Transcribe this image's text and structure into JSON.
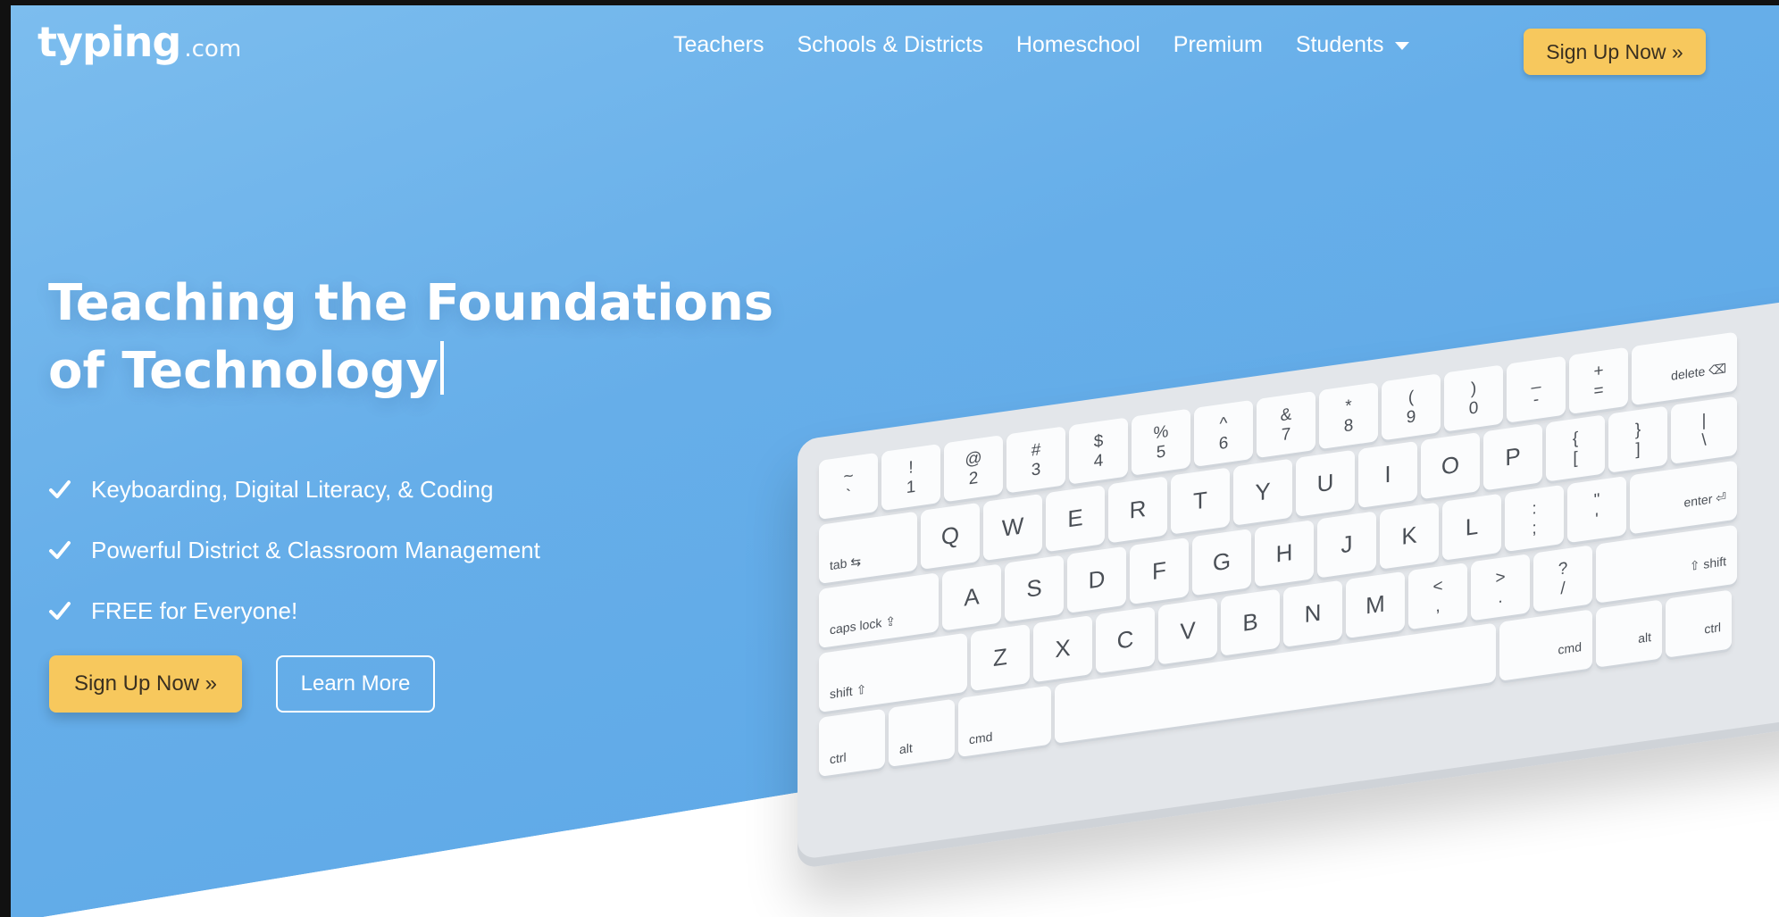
{
  "header": {
    "logo_main": "typing",
    "logo_suffix": ".com",
    "nav": {
      "teachers": "Teachers",
      "schools": "Schools & Districts",
      "homeschool": "Homeschool",
      "premium": "Premium",
      "students": "Students"
    },
    "cta": "Sign Up Now »"
  },
  "hero": {
    "headline_line1": "Teaching the Foundations",
    "headline_line2": "of Technology",
    "features": [
      "Keyboarding, Digital Literacy, & Coding",
      "Powerful District & Classroom Management",
      "FREE for Everyone!"
    ],
    "signup_label": "Sign Up Now »",
    "learn_more_label": "Learn More"
  },
  "keyboard": {
    "row1": [
      {
        "top": "~",
        "bot": "`"
      },
      {
        "top": "!",
        "bot": "1"
      },
      {
        "top": "@",
        "bot": "2"
      },
      {
        "top": "#",
        "bot": "3"
      },
      {
        "top": "$",
        "bot": "4"
      },
      {
        "top": "%",
        "bot": "5"
      },
      {
        "top": "^",
        "bot": "6"
      },
      {
        "top": "&",
        "bot": "7"
      },
      {
        "top": "*",
        "bot": "8"
      },
      {
        "top": "(",
        "bot": "9"
      },
      {
        "top": ")",
        "bot": "0"
      },
      {
        "top": "_",
        "bot": "-"
      },
      {
        "top": "+",
        "bot": "="
      },
      {
        "label_r": "delete ⌫"
      }
    ],
    "row2": [
      {
        "label_l": "tab ⇆"
      },
      {
        "main": "Q"
      },
      {
        "main": "W"
      },
      {
        "main": "E"
      },
      {
        "main": "R"
      },
      {
        "main": "T"
      },
      {
        "main": "Y"
      },
      {
        "main": "U"
      },
      {
        "main": "I"
      },
      {
        "main": "O"
      },
      {
        "main": "P"
      },
      {
        "top": "{",
        "bot": "["
      },
      {
        "top": "}",
        "bot": "]"
      },
      {
        "top": "|",
        "bot": "\\"
      }
    ],
    "row3": [
      {
        "label_l": "caps lock ⇪"
      },
      {
        "main": "A"
      },
      {
        "main": "S"
      },
      {
        "main": "D"
      },
      {
        "main": "F"
      },
      {
        "main": "G"
      },
      {
        "main": "H"
      },
      {
        "main": "J"
      },
      {
        "main": "K"
      },
      {
        "main": "L"
      },
      {
        "top": ":",
        "bot": ";"
      },
      {
        "top": "\"",
        "bot": "'"
      },
      {
        "label_r": "enter ⏎"
      }
    ],
    "row4": [
      {
        "label_l": "shift ⇧"
      },
      {
        "main": "Z"
      },
      {
        "main": "X"
      },
      {
        "main": "C"
      },
      {
        "main": "V"
      },
      {
        "main": "B"
      },
      {
        "main": "N"
      },
      {
        "main": "M"
      },
      {
        "top": "<",
        "bot": ","
      },
      {
        "top": ">",
        "bot": "."
      },
      {
        "top": "?",
        "bot": "/"
      },
      {
        "label_r": "⇧ shift"
      }
    ],
    "row5": [
      {
        "label_l": "ctrl"
      },
      {
        "label_l": "alt"
      },
      {
        "label_l": "cmd"
      },
      {},
      {
        "label_r": "cmd"
      },
      {
        "label_r": "alt"
      },
      {
        "label_r": "ctrl"
      }
    ]
  },
  "colors": {
    "hero_blue": "#66aee9",
    "accent_yellow": "#f7c85d"
  }
}
